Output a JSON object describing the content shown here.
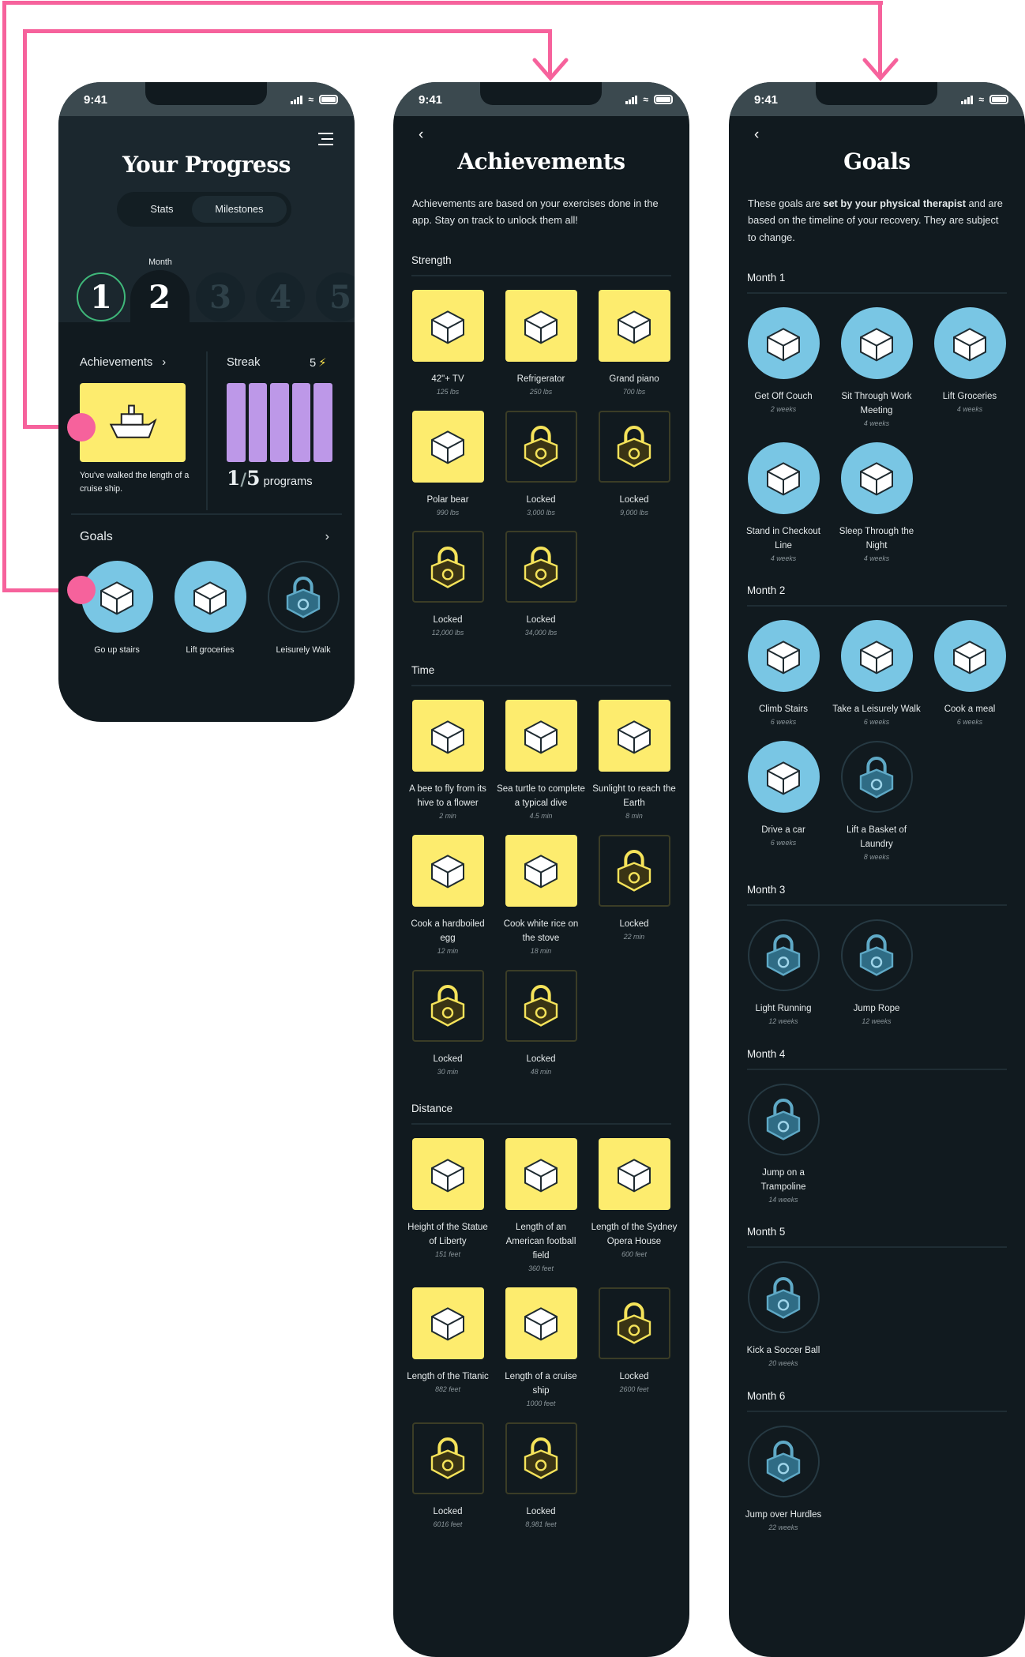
{
  "colors": {
    "accent_pink": "#f6629c",
    "tile_yellow": "#fdec6e",
    "goal_blue": "#79c6e4",
    "streak_purple": "#bd98e8",
    "month_ring_green": "#3fb87a",
    "background": "#111a1f"
  },
  "status_bar": {
    "time": "9:41"
  },
  "progress": {
    "title": "Your Progress",
    "tabs": [
      {
        "label": "Stats",
        "active": false
      },
      {
        "label": "Milestones",
        "active": true
      }
    ],
    "month_label": "Month",
    "months": [
      "1",
      "2",
      "3",
      "4",
      "5"
    ],
    "achievements": {
      "title": "Achievements",
      "caption": "You've walked the length of a cruise ship.",
      "icon": "cruise-ship-icon"
    },
    "streak": {
      "title": "Streak",
      "count": "5",
      "icon": "lightning-icon",
      "filled_bars": 5,
      "total_bars": 5,
      "fraction_num": "1",
      "fraction_den": "5",
      "fraction_sep": "/",
      "unit": "programs"
    },
    "goals": {
      "title": "Goals",
      "items": [
        {
          "label": "Go up stairs",
          "icon": "stairs-icon",
          "locked": false
        },
        {
          "label": "Lift groceries",
          "icon": "shopping-bag-icon",
          "locked": false
        },
        {
          "label": "Leisurely Walk",
          "icon": "lock-icon",
          "locked": true
        }
      ]
    }
  },
  "achievements_page": {
    "title": "Achievements",
    "description": "Achievements are based on your exercises done in the app. Stay on track to unlock them all!",
    "sections": [
      {
        "title": "Strength",
        "items": [
          {
            "label": "42\"+ TV",
            "sub": "125 lbs",
            "locked": false,
            "icon": "tv-icon"
          },
          {
            "label": "Refrigerator",
            "sub": "250 lbs",
            "locked": false,
            "icon": "refrigerator-icon"
          },
          {
            "label": "Grand piano",
            "sub": "700 lbs",
            "locked": false,
            "icon": "piano-icon"
          },
          {
            "label": "Polar bear",
            "sub": "990 lbs",
            "locked": false,
            "icon": "polar-bear-icon"
          },
          {
            "label": "Locked",
            "sub": "3,000 lbs",
            "locked": true,
            "icon": "lock-icon"
          },
          {
            "label": "Locked",
            "sub": "9,000 lbs",
            "locked": true,
            "icon": "lock-icon"
          },
          {
            "label": "Locked",
            "sub": "12,000 lbs",
            "locked": true,
            "icon": "lock-icon"
          },
          {
            "label": "Locked",
            "sub": "34,000 lbs",
            "locked": true,
            "icon": "lock-icon"
          }
        ]
      },
      {
        "title": "Time",
        "items": [
          {
            "label": "A bee to fly from its hive to a flower",
            "sub": "2 min",
            "locked": false,
            "icon": "bee-icon"
          },
          {
            "label": "Sea turtle to complete a typical dive",
            "sub": "4.5 min",
            "locked": false,
            "icon": "turtle-icon"
          },
          {
            "label": "Sunlight to reach the Earth",
            "sub": "8 min",
            "locked": false,
            "icon": "sun-icon"
          },
          {
            "label": "Cook a hardboiled egg",
            "sub": "12 min",
            "locked": false,
            "icon": "egg-icon"
          },
          {
            "label": "Cook white rice on the stove",
            "sub": "18 min",
            "locked": false,
            "icon": "rice-bowl-icon"
          },
          {
            "label": "Locked",
            "sub": "22 min",
            "locked": true,
            "icon": "lock-icon"
          },
          {
            "label": "Locked",
            "sub": "30 min",
            "locked": true,
            "icon": "lock-icon"
          },
          {
            "label": "Locked",
            "sub": "48 min",
            "locked": true,
            "icon": "lock-icon"
          }
        ]
      },
      {
        "title": "Distance",
        "items": [
          {
            "label": "Height of the Statue of Liberty",
            "sub": "151 feet",
            "locked": false,
            "icon": "statue-of-liberty-icon"
          },
          {
            "label": "Length of an American football field",
            "sub": "360 feet",
            "locked": false,
            "icon": "football-field-icon"
          },
          {
            "label": "Length of the Sydney Opera House",
            "sub": "600 feet",
            "locked": false,
            "icon": "opera-house-icon"
          },
          {
            "label": "Length of the Titanic",
            "sub": "882 feet",
            "locked": false,
            "icon": "titanic-icon"
          },
          {
            "label": "Length of a cruise ship",
            "sub": "1000 feet",
            "locked": false,
            "icon": "cruise-ship-icon"
          },
          {
            "label": "Locked",
            "sub": "2600 feet",
            "locked": true,
            "icon": "lock-icon"
          },
          {
            "label": "Locked",
            "sub": "6016 feet",
            "locked": true,
            "icon": "lock-icon"
          },
          {
            "label": "Locked",
            "sub": "8,981 feet",
            "locked": true,
            "icon": "lock-icon"
          }
        ]
      }
    ]
  },
  "goals_page": {
    "title": "Goals",
    "description_pre": "These goals are ",
    "description_bold": "set by your physical therapist",
    "description_post": " and are based on the timeline of your recovery. They are subject to change.",
    "months": [
      {
        "title": "Month 1",
        "items": [
          {
            "label": "Get Off Couch",
            "sub": "2 weeks",
            "locked": false,
            "icon": "couch-icon"
          },
          {
            "label": "Sit Through Work Meeting",
            "sub": "4 weeks",
            "locked": false,
            "icon": "laptop-icon"
          },
          {
            "label": "Lift Groceries",
            "sub": "4 weeks",
            "locked": false,
            "icon": "shopping-bag-icon"
          },
          {
            "label": "Stand in Checkout Line",
            "sub": "4 weeks",
            "locked": false,
            "icon": "store-icon"
          },
          {
            "label": "Sleep Through the Night",
            "sub": "4 weeks",
            "locked": false,
            "icon": "bed-icon"
          }
        ]
      },
      {
        "title": "Month 2",
        "items": [
          {
            "label": "Climb Stairs",
            "sub": "6 weeks",
            "locked": false,
            "icon": "stairs-icon"
          },
          {
            "label": "Take a Leisurely Walk",
            "sub": "6 weeks",
            "locked": false,
            "icon": "walking-icon"
          },
          {
            "label": "Cook a meal",
            "sub": "6 weeks",
            "locked": false,
            "icon": "stove-icon"
          },
          {
            "label": "Drive a car",
            "sub": "6 weeks",
            "locked": false,
            "icon": "car-icon"
          },
          {
            "label": "Lift a Basket of Laundry",
            "sub": "8 weeks",
            "locked": true,
            "icon": "lock-icon"
          }
        ]
      },
      {
        "title": "Month 3",
        "items": [
          {
            "label": "Light Running",
            "sub": "12 weeks",
            "locked": true,
            "icon": "lock-icon"
          },
          {
            "label": "Jump Rope",
            "sub": "12 weeks",
            "locked": true,
            "icon": "lock-icon"
          }
        ]
      },
      {
        "title": "Month 4",
        "items": [
          {
            "label": "Jump on a Trampoline",
            "sub": "14 weeks",
            "locked": true,
            "icon": "lock-icon"
          }
        ]
      },
      {
        "title": "Month 5",
        "items": [
          {
            "label": "Kick a Soccer Ball",
            "sub": "20 weeks",
            "locked": true,
            "icon": "lock-icon"
          }
        ]
      },
      {
        "title": "Month 6",
        "items": [
          {
            "label": "Jump over Hurdles",
            "sub": "22 weeks",
            "locked": true,
            "icon": "lock-icon"
          }
        ]
      }
    ]
  }
}
